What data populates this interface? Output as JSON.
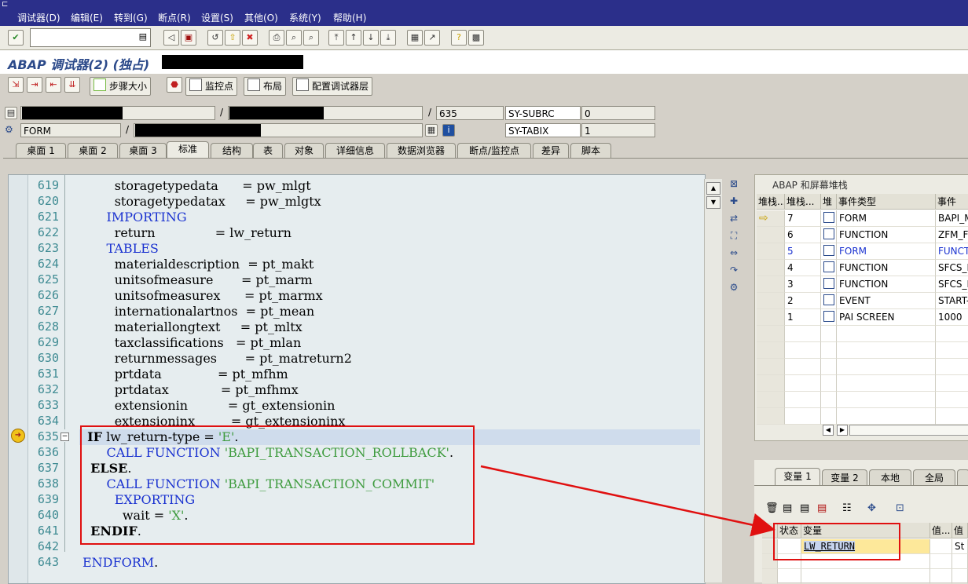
{
  "menu": [
    "调试器(D)",
    "编辑(E)",
    "转到(G)",
    "断点(R)",
    "设置(S)",
    "其他(O)",
    "系统(Y)",
    "帮助(H)"
  ],
  "title": "ABAP 调试器(2) (独占)",
  "app_toolbar": {
    "step_size": "步骤大小",
    "watchpoint": "监控点",
    "layout": "布局",
    "config": "配置调试器层"
  },
  "info": {
    "row1_sep": "/",
    "row1_sep2": "/",
    "line": "635",
    "sy_subrc_label": "SY-SUBRC",
    "sy_subrc_value": "0",
    "row2_type": "FORM",
    "row2_sep": "/",
    "sy_tabix_label": "SY-TABIX",
    "sy_tabix_value": "1"
  },
  "tabs": [
    "桌面 1",
    "桌面 2",
    "桌面 3",
    "标准",
    "结构",
    "表",
    "对象",
    "详细信息",
    "数据浏览器",
    "断点/监控点",
    "差异",
    "脚本"
  ],
  "code": [
    {
      "n": "619",
      "text": "        storagetypedata      = pw_mlgt"
    },
    {
      "n": "620",
      "text": "        storagetypedatax     = pw_mlgtx"
    },
    {
      "n": "621",
      "text": "      IMPORTING"
    },
    {
      "n": "622",
      "text": "        return               = lw_return"
    },
    {
      "n": "623",
      "text": "      TABLES"
    },
    {
      "n": "624",
      "text": "        materialdescription  = pt_makt"
    },
    {
      "n": "625",
      "text": "        unitsofmeasure       = pt_marm"
    },
    {
      "n": "626",
      "text": "        unitsofmeasurex      = pt_marmx"
    },
    {
      "n": "627",
      "text": "        internationalartnos  = pt_mean"
    },
    {
      "n": "628",
      "text": "        materiallongtext     = pt_mltx"
    },
    {
      "n": "629",
      "text": "        taxclassifications   = pt_mlan"
    },
    {
      "n": "630",
      "text": "        returnmessages       = pt_matreturn2"
    },
    {
      "n": "631",
      "text": "        prtdata              = pt_mfhm"
    },
    {
      "n": "632",
      "text": "        prtdatax             = pt_mfhmx"
    },
    {
      "n": "633",
      "text": "        extensionin          = gt_extensionin"
    },
    {
      "n": "634",
      "text": "        extensioninx         = gt_extensioninx"
    },
    {
      "n": "635",
      "text": "  IF lw_return-type = 'E'."
    },
    {
      "n": "636",
      "text": "      CALL FUNCTION 'BAPI_TRANSACTION_ROLLBACK'."
    },
    {
      "n": "637",
      "text": "  ELSE."
    },
    {
      "n": "638",
      "text": "      CALL FUNCTION 'BAPI_TRANSACTION_COMMIT'"
    },
    {
      "n": "639",
      "text": "        EXPORTING"
    },
    {
      "n": "640",
      "text": "          wait = 'X'."
    },
    {
      "n": "641",
      "text": "  ENDIF."
    },
    {
      "n": "642",
      "text": ""
    },
    {
      "n": "643",
      "text": "ENDFORM."
    }
  ],
  "stack": {
    "title": "ABAP 和屏幕堆栈",
    "headers": [
      "堆栈...",
      "堆栈...",
      "堆",
      "事件类型",
      "事件"
    ],
    "rows": [
      {
        "level": "7",
        "type": "FORM",
        "event": "BAPI_M",
        "current": true
      },
      {
        "level": "6",
        "type": "FUNCTION",
        "event": "ZFM_FI_"
      },
      {
        "level": "5",
        "type": "FORM",
        "event": "FUNCTI",
        "highlight": true
      },
      {
        "level": "4",
        "type": "FUNCTION",
        "event": "SFCS_F"
      },
      {
        "level": "3",
        "type": "FUNCTION",
        "event": "SFCS_F"
      },
      {
        "level": "2",
        "type": "EVENT",
        "event": "START-"
      },
      {
        "level": "1",
        "type": "PAI SCREEN",
        "event": "1000"
      }
    ]
  },
  "var_tabs": [
    "变量 1",
    "变量 2",
    "本地",
    "全局"
  ],
  "var_headers": [
    "状态",
    "变量",
    "值...",
    "值"
  ],
  "var_rows": [
    {
      "name": "LW_RETURN",
      "value": "St"
    }
  ]
}
